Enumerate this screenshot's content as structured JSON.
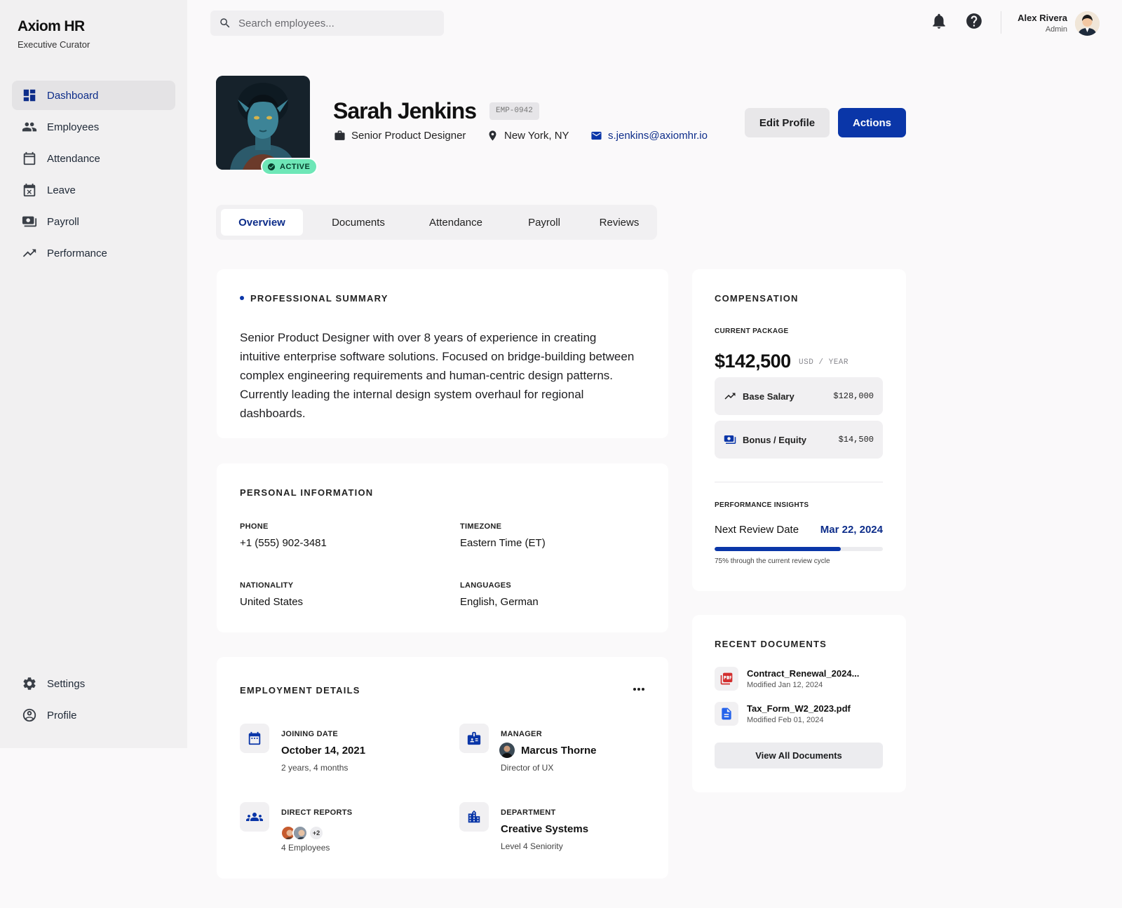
{
  "brand": {
    "title": "Axiom HR",
    "subtitle": "Executive Curator"
  },
  "nav": {
    "items": [
      {
        "label": "Dashboard",
        "icon": "dashboard-icon"
      },
      {
        "label": "Employees",
        "icon": "people-icon"
      },
      {
        "label": "Attendance",
        "icon": "calendar-icon"
      },
      {
        "label": "Leave",
        "icon": "calendar-x-icon"
      },
      {
        "label": "Payroll",
        "icon": "payments-icon"
      },
      {
        "label": "Performance",
        "icon": "trending-up-icon"
      }
    ],
    "bottom": [
      {
        "label": "Settings",
        "icon": "gear-icon"
      },
      {
        "label": "Profile",
        "icon": "account-circle-icon"
      }
    ]
  },
  "search": {
    "placeholder": "Search employees..."
  },
  "user": {
    "name": "Alex Rivera",
    "role": "Admin"
  },
  "employee": {
    "name": "Sarah Jenkins",
    "id": "EMP-0942",
    "status": "ACTIVE",
    "title": "Senior Product Designer",
    "location": "New York, NY",
    "email": "s.jenkins@axiomhr.io"
  },
  "actions": {
    "edit": "Edit Profile",
    "actions": "Actions"
  },
  "tabs": [
    "Overview",
    "Documents",
    "Attendance",
    "Payroll",
    "Reviews"
  ],
  "summary": {
    "heading": "PROFESSIONAL SUMMARY",
    "text": "Senior Product Designer with over 8 years of experience in creating intuitive enterprise software solutions. Focused on bridge-building between complex engineering requirements and human-centric design patterns. Currently leading the internal design system overhaul for regional dashboards."
  },
  "personal": {
    "heading": "PERSONAL INFORMATION",
    "phone_label": "PHONE",
    "phone": "+1 (555) 902-3481",
    "timezone_label": "TIMEZONE",
    "timezone": "Eastern Time (ET)",
    "nationality_label": "NATIONALITY",
    "nationality": "United States",
    "languages_label": "LANGUAGES",
    "languages": "English, German"
  },
  "employment": {
    "heading": "EMPLOYMENT DETAILS",
    "joining_label": "JOINING DATE",
    "joining": "October 14, 2021",
    "joining_sub": "2 years, 4 months",
    "manager_label": "MANAGER",
    "manager": "Marcus Thorne",
    "manager_sub": "Director of UX",
    "reports_label": "DIRECT REPORTS",
    "reports_more": "+2",
    "reports_sub": "4 Employees",
    "dept_label": "DEPARTMENT",
    "dept": "Creative Systems",
    "dept_sub": "Level 4 Seniority"
  },
  "compensation": {
    "heading": "COMPENSATION",
    "package_label": "CURRENT PACKAGE",
    "package": "$142,500",
    "unit": "USD / YEAR",
    "base_label": "Base Salary",
    "base": "$128,000",
    "bonus_label": "Bonus / Equity",
    "bonus": "$14,500",
    "perf_label": "PERFORMANCE INSIGHTS",
    "review_label": "Next Review Date",
    "review_date": "Mar 22, 2024",
    "progress": 0.75,
    "progress_text": "75% through the current review cycle"
  },
  "documents": {
    "heading": "RECENT DOCUMENTS",
    "items": [
      {
        "name": "Contract_Renewal_2024...",
        "modified": "Modified Jan 12, 2024",
        "icon": "pdf-icon"
      },
      {
        "name": "Tax_Form_W2_2023.pdf",
        "modified": "Modified Feb 01, 2024",
        "icon": "doc-icon"
      }
    ],
    "view_all": "View All Documents"
  },
  "colors": {
    "accent": "#0a36a8",
    "active_badge": "#6ee7b7",
    "pdf": "#d32f2f",
    "doc": "#2563eb"
  }
}
